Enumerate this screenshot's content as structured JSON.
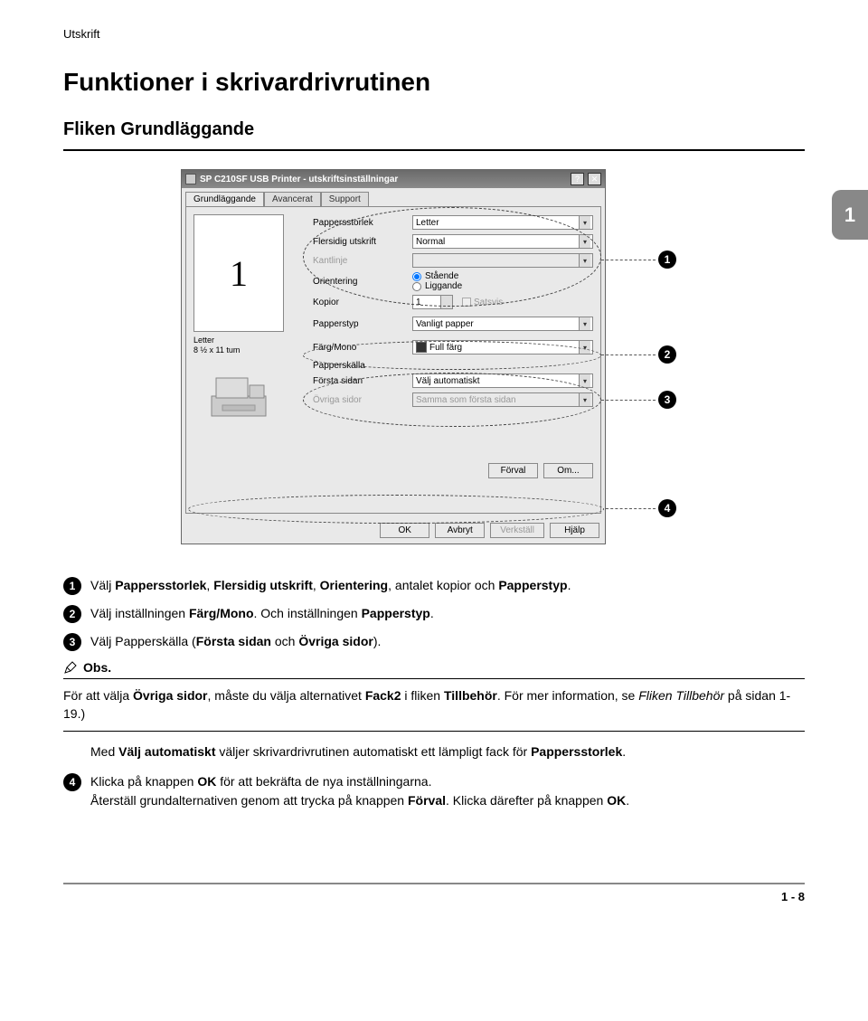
{
  "header": "Utskrift",
  "h1": "Funktioner i skrivardrivrutinen",
  "h2": "Fliken Grundläggande",
  "chapter": "1",
  "dialog": {
    "title": "SP C210SF USB Printer - utskriftsinställningar",
    "help_btn": "?",
    "close_btn": "✕",
    "tabs": {
      "t1": "Grundläggande",
      "t2": "Avancerat",
      "t3": "Support"
    },
    "preview_number": "1",
    "preview_caption_l1": "Letter",
    "preview_caption_l2": "8 ½ x 11 tum",
    "labels": {
      "pappersstorlek": "Pappersstorlek",
      "flersidig": "Flersidig utskrift",
      "kantlinje": "Kantlinje",
      "orientering": "Orientering",
      "kopior": "Kopior",
      "papperstyp": "Papperstyp",
      "fargmono": "Färg/Mono",
      "papperskalla": "Papperskälla",
      "forsta_sidan": "Första sidan",
      "ovriga_sidor": "Övriga sidor"
    },
    "values": {
      "pappersstorlek": "Letter",
      "flersidig": "Normal",
      "kantlinje": "",
      "orient_staende": "Stående",
      "orient_liggande": "Liggande",
      "kopior": "1",
      "satsvis": "Satsvis",
      "papperstyp": "Vanligt papper",
      "fargmono": "Full färg",
      "forsta_sidan": "Välj automatiskt",
      "ovriga_sidor": "Samma som första sidan"
    },
    "mid_buttons": {
      "forval": "Förval",
      "om": "Om..."
    },
    "buttons": {
      "ok": "OK",
      "avbryt": "Avbryt",
      "verkstall": "Verkställ",
      "hjalp": "Hjälp"
    }
  },
  "callouts": {
    "c1": "1",
    "c2": "2",
    "c3": "3",
    "c4": "4"
  },
  "steps": {
    "s1": {
      "num": "1",
      "pre": "Välj ",
      "b1": "Pappersstorlek",
      "m1": ", ",
      "b2": "Flersidig utskrift",
      "m2": ", ",
      "b3": "Orientering",
      "m3": ", antalet kopior och ",
      "b4": "Papperstyp",
      "post": "."
    },
    "s2": {
      "num": "2",
      "pre": "Välj inställningen ",
      "b1": "Färg/Mono",
      "m1": ". Och inställningen ",
      "b2": "Papperstyp",
      "post": "."
    },
    "s3": {
      "num": "3",
      "pre": "Välj Papperskälla (",
      "b1": "Första sidan",
      "m1": " och ",
      "b2": "Övriga sidor",
      "post": ")."
    },
    "s4": {
      "num": "4",
      "l1a": "Klicka på knappen ",
      "l1b": "OK",
      "l1c": " för att bekräfta de nya inställningarna.",
      "l2a": "Återställ grundalternativen genom att trycka på knappen ",
      "l2b": "Förval",
      "l2c": ". Klicka därefter på knappen ",
      "l2d": "OK",
      "l2e": "."
    }
  },
  "note": {
    "head": "Obs.",
    "body_a": "För att välja ",
    "body_b": "Övriga sidor",
    "body_c": ", måste du välja alternativet ",
    "body_d": "Fack2",
    "body_e": " i fliken ",
    "body_f": "Tillbehör",
    "body_g": ". För mer information, se ",
    "body_h": "Fliken Tillbehör",
    "body_i": " på sidan 1-19.)"
  },
  "auto_para_a": "Med ",
  "auto_para_b": "Välj automatiskt",
  "auto_para_c": " väljer skrivardrivrutinen automatiskt ett lämpligt fack för ",
  "auto_para_d": "Pappersstorlek",
  "auto_para_e": ".",
  "page_num": "1 - 8"
}
